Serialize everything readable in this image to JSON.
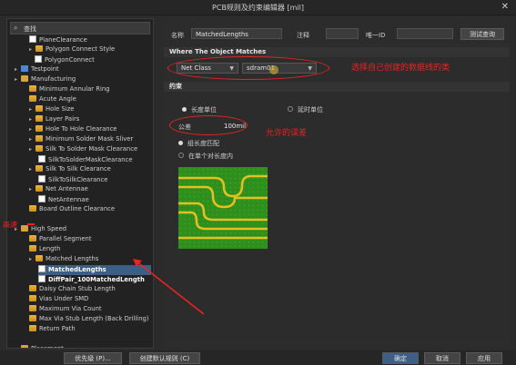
{
  "window": {
    "title": "PCB规则及约束编辑器 [mil]",
    "close": "✕"
  },
  "search": {
    "placeholder": "查找"
  },
  "tree": [
    {
      "label": "PlaneClearance",
      "icon": "sub"
    },
    {
      "label": "Polygon Connect Style",
      "icon": "rule"
    },
    {
      "label": "PolygonConnect",
      "icon": "sub"
    },
    {
      "label": "Testpoint",
      "icon": "tp"
    },
    {
      "label": "Manufacturing",
      "icon": "folder"
    },
    {
      "label": "Minimum Annular Ring",
      "icon": "rule"
    },
    {
      "label": "Acute Angle",
      "icon": "rule"
    },
    {
      "label": "Hole Size",
      "icon": "rule"
    },
    {
      "label": "Layer Pairs",
      "icon": "rule"
    },
    {
      "label": "Hole To Hole Clearance",
      "icon": "rule"
    },
    {
      "label": "Minimum Solder Mask Sliver",
      "icon": "rule"
    },
    {
      "label": "Silk To Solder Mask Clearance",
      "icon": "rule"
    },
    {
      "label": "SilkToSolderMaskClearance",
      "icon": "sub"
    },
    {
      "label": "Silk To Silk Clearance",
      "icon": "rule"
    },
    {
      "label": "SilkToSilkClearance",
      "icon": "sub"
    },
    {
      "label": "Net Antennae",
      "icon": "rule"
    },
    {
      "label": "NetAntennae",
      "icon": "sub"
    },
    {
      "label": "Board Outline Clearance",
      "icon": "rule"
    },
    {
      "label": "",
      "icon": "none"
    },
    {
      "label": "High Speed",
      "icon": "folder"
    },
    {
      "label": "Parallel Segment",
      "icon": "rule"
    },
    {
      "label": "Length",
      "icon": "rule"
    },
    {
      "label": "Matched Lengths",
      "icon": "rule"
    },
    {
      "label": "MatchedLengths",
      "icon": "sub"
    },
    {
      "label": "DiffPair_100MatchedLength",
      "icon": "sub"
    },
    {
      "label": "Daisy Chain Stub Length",
      "icon": "rule"
    },
    {
      "label": "Vias Under SMD",
      "icon": "rule"
    },
    {
      "label": "Maximum Via Count",
      "icon": "rule"
    },
    {
      "label": "Max Via Stub Length (Back Drilling)",
      "icon": "rule"
    },
    {
      "label": "Return Path",
      "icon": "rule"
    },
    {
      "label": "",
      "icon": "none"
    },
    {
      "label": "Placement",
      "icon": "folder"
    }
  ],
  "annotations": {
    "highspeed": "高速",
    "netclass_note": "选择自己创建的数据线的类",
    "tolerance_note": "允许的误差"
  },
  "form": {
    "name_label": "名称",
    "name_value": "MatchedLengths",
    "comment_label": "注释",
    "uid_label": "唯一ID",
    "uid_value": "",
    "test_btn": "测试查询"
  },
  "where": {
    "title": "Where The Object Matches",
    "dd1": "Net Class",
    "dd2": "sdram01"
  },
  "constraints": {
    "title": "约束",
    "radio_a": "长度单位",
    "radio_b": "延时单位",
    "tol_label": "公差",
    "tol_value": "100mil",
    "opt1": "组长度匹配",
    "opt2": "在单个对长度内"
  },
  "bottom": {
    "priority_btn": "优先级 (P)...",
    "rule_wizard_btn": "创建默认规则 (C)",
    "ok_btn": "确定",
    "cancel_btn": "取消",
    "apply_btn": "应用"
  },
  "colors": {
    "red": "#e22222",
    "selection": "#3d5f86",
    "board": "#2e8d1a",
    "trace": "#e4c021"
  }
}
